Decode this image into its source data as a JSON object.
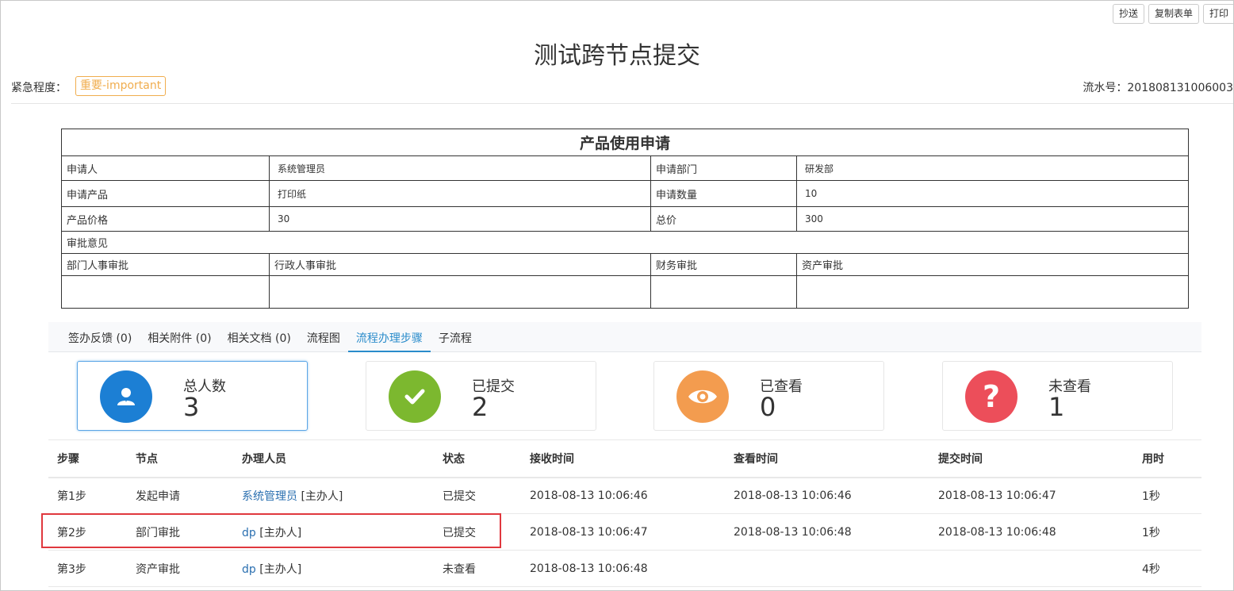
{
  "toolbar": {
    "cc_label": "抄送",
    "copy_label": "复制表单",
    "print_label": "打印"
  },
  "page_title": "测试跨节点提交",
  "urgency": {
    "label": "紧急程度：",
    "value": "重要-important"
  },
  "serial": "流水号：201808131006003",
  "form": {
    "title": "产品使用申请",
    "applicant_label": "申请人",
    "applicant": "系统管理员",
    "dept_label": "申请部门",
    "dept": "研发部",
    "product_label": "申请产品",
    "product": "打印纸",
    "qty_label": "申请数量",
    "qty": "10",
    "price_label": "产品价格",
    "price": "30",
    "total_label": "总价",
    "total": "300",
    "opinion_label": "审批意见",
    "approvals": [
      "部门人事审批",
      "行政人事审批",
      "财务审批",
      "资产审批"
    ]
  },
  "tabs": [
    "签办反馈 (0)",
    "相关附件 (0)",
    "相关文档 (0)",
    "流程图",
    "流程办理步骤",
    "子流程"
  ],
  "active_tab": 4,
  "stats": [
    {
      "label": "总人数",
      "value": "3",
      "color": "#1c7fd4",
      "icon": "user-icon"
    },
    {
      "label": "已提交",
      "value": "2",
      "color": "#7cb82f",
      "icon": "check-icon"
    },
    {
      "label": "已查看",
      "value": "0",
      "color": "#f39c4f",
      "icon": "eye-icon"
    },
    {
      "label": "未查看",
      "value": "1",
      "color": "#ec4e5a",
      "icon": "question-icon"
    }
  ],
  "steps": {
    "headers": [
      "步骤",
      "节点",
      "办理人员",
      "状态",
      "接收时间",
      "查看时间",
      "提交时间",
      "用时"
    ],
    "rows": [
      {
        "step": "第1步",
        "node": "发起申请",
        "handler": "系统管理员",
        "role": " [主办人]",
        "status": "已提交",
        "received": "2018-08-13 10:06:46",
        "viewed": "2018-08-13 10:06:46",
        "submitted": "2018-08-13 10:06:47",
        "duration": "1秒"
      },
      {
        "step": "第2步",
        "node": "部门审批",
        "handler": "dp",
        "role": " [主办人]",
        "status": "已提交",
        "received": "2018-08-13 10:06:47",
        "viewed": "2018-08-13 10:06:48",
        "submitted": "2018-08-13 10:06:48",
        "duration": "1秒"
      },
      {
        "step": "第3步",
        "node": "资产审批",
        "handler": "dp",
        "role": " [主办人]",
        "status": "未查看",
        "received": "2018-08-13 10:06:48",
        "viewed": "",
        "submitted": "",
        "duration": "4秒"
      }
    ]
  }
}
